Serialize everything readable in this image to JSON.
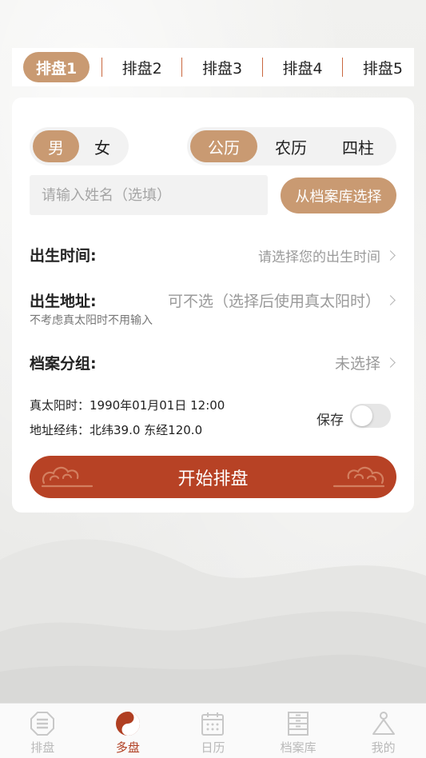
{
  "tabs": [
    {
      "label": "排盘1",
      "active": true
    },
    {
      "label": "排盘2",
      "active": false
    },
    {
      "label": "排盘3",
      "active": false
    },
    {
      "label": "排盘4",
      "active": false
    },
    {
      "label": "排盘5",
      "active": false
    }
  ],
  "gender": {
    "options": [
      "男",
      "女"
    ],
    "selected": "男"
  },
  "calendar": {
    "options": [
      "公历",
      "农历",
      "四柱"
    ],
    "selected": "公历"
  },
  "name_input": {
    "placeholder": "请输入姓名（选填）",
    "value": ""
  },
  "archive_button": "从档案库选择",
  "birth_time": {
    "label": "出生时间:",
    "value": "请选择您的出生时间"
  },
  "birth_address": {
    "label": "出生地址:",
    "value": "可不选（选择后使用真太阳时）",
    "hint": "不考虑真太阳时不用输入"
  },
  "archive_group": {
    "label": "档案分组:",
    "value": "未选择"
  },
  "true_solar_time": "真太阳时：1990年01月01日 12:00",
  "address_coords": "地址经纬：北纬39.0 东经120.0",
  "save": {
    "label": "保存",
    "on": false
  },
  "start_button": "开始排盘",
  "bottom_nav": [
    {
      "label": "排盘",
      "icon": "paipan-icon",
      "active": false
    },
    {
      "label": "多盘",
      "icon": "yin-yang-icon",
      "active": true
    },
    {
      "label": "日历",
      "icon": "calendar-icon",
      "active": false
    },
    {
      "label": "档案库",
      "icon": "cabinet-icon",
      "active": false
    },
    {
      "label": "我的",
      "icon": "profile-icon",
      "active": false
    }
  ],
  "colors": {
    "accent": "#c99a72",
    "primary_button": "#b74225",
    "active_nav": "#b03f22"
  }
}
